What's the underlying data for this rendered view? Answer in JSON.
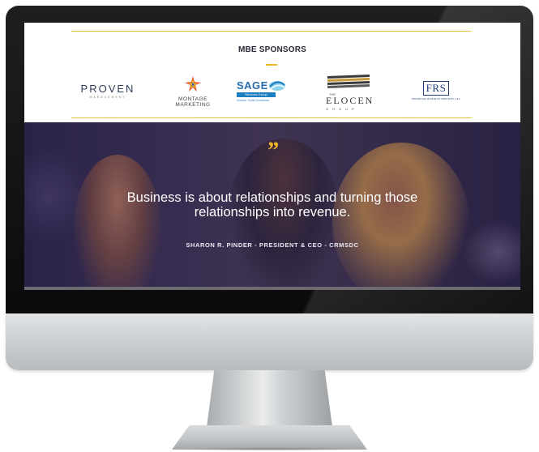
{
  "sponsors": {
    "title": "MBE SPONSORS",
    "logos": [
      {
        "name": "PROVEN",
        "sub": "MANAGEMENT"
      },
      {
        "name": "MONTAGE",
        "line2": "MARKETING"
      },
      {
        "name": "SAGE",
        "bar": "Services Group",
        "tagline": "Sound, Solid Solutions"
      },
      {
        "pre": "THE",
        "name": "ELOCEN",
        "sub": "GROUP"
      },
      {
        "name": "FRS",
        "sub": "FINANCIAL & REALTY SERVICES, LLC"
      }
    ]
  },
  "hero": {
    "quote_mark": "”",
    "quote": "Business is about relationships and turning those relationships into revenue.",
    "author": "SHARON R. PINDER - PRESIDENT & CEO - CRMSDC"
  },
  "colors": {
    "accent": "#f0b429",
    "rule": "#f0c040",
    "hero_overlay": "#2c2545"
  }
}
